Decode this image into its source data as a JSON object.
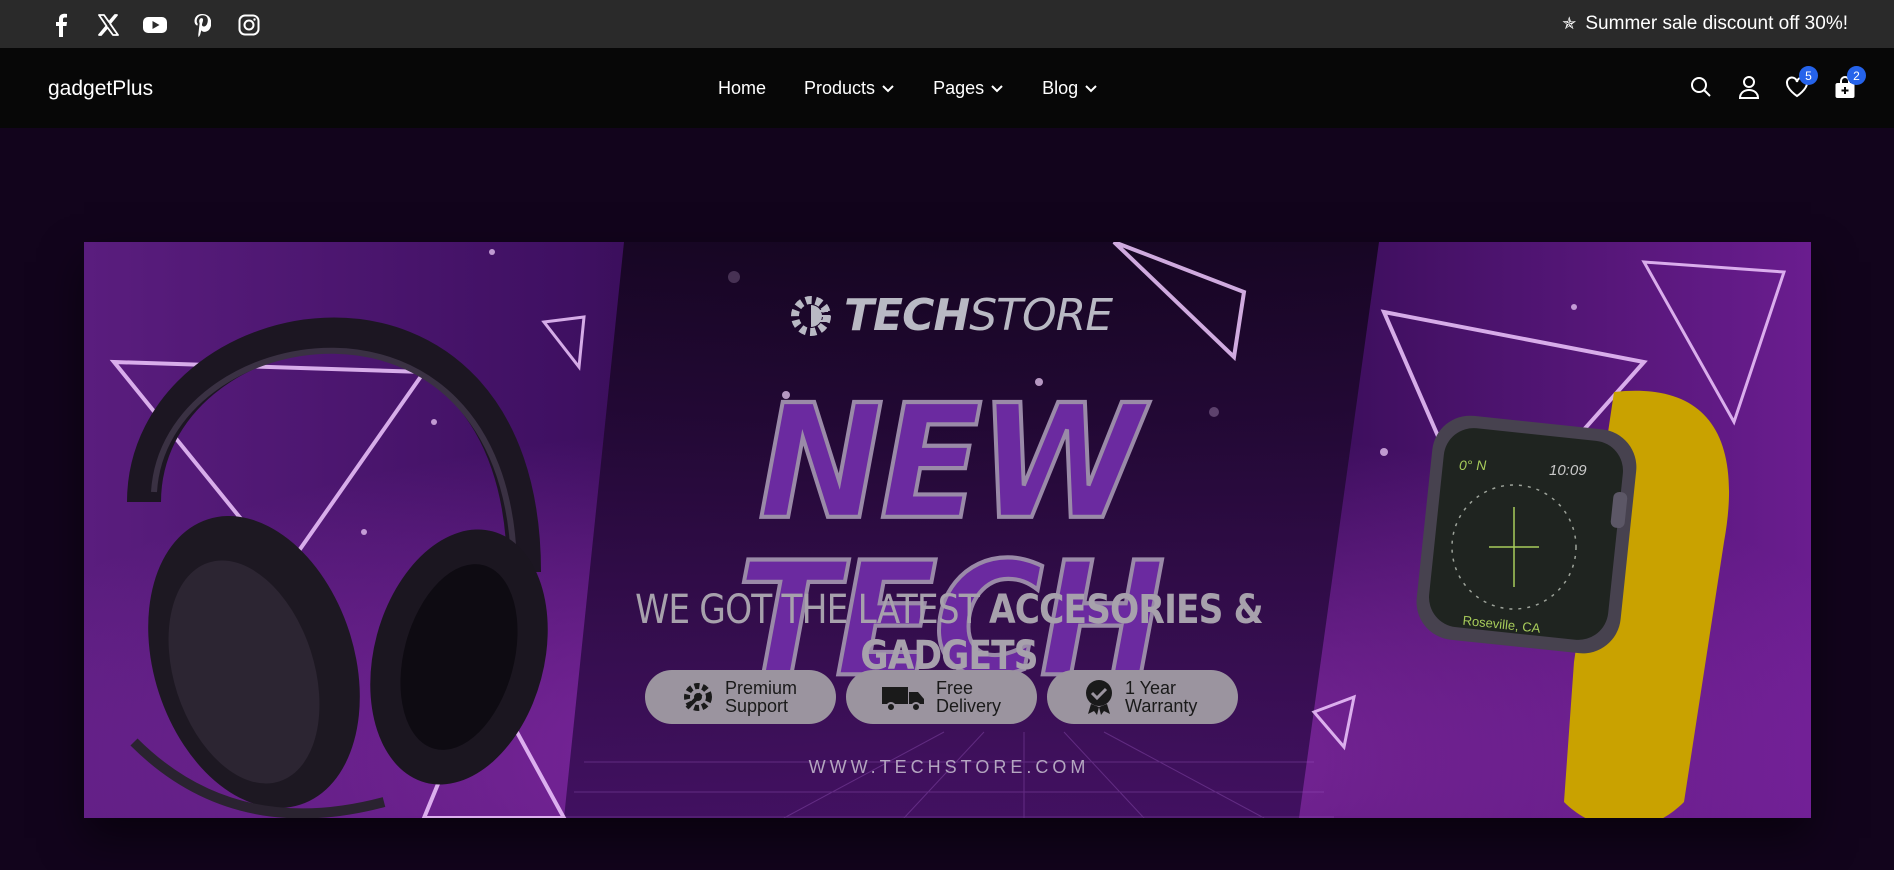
{
  "topbar": {
    "social_icons": [
      "facebook-icon",
      "x-icon",
      "youtube-icon",
      "pinterest-icon",
      "instagram-icon"
    ],
    "promo_icon": "star-icon",
    "promo_text": "Summer sale discount off 30%!"
  },
  "navbar": {
    "logo": "gadgetPlus",
    "menu": [
      {
        "label": "Home",
        "dropdown": false
      },
      {
        "label": "Products",
        "dropdown": true
      },
      {
        "label": "Pages",
        "dropdown": true
      },
      {
        "label": "Blog",
        "dropdown": true
      }
    ],
    "actions": {
      "search_icon": "search-icon",
      "account_icon": "user-icon",
      "wishlist_count": "5",
      "cart_count": "2"
    }
  },
  "banner": {
    "brand_bold": "TECH",
    "brand_light": "STORE",
    "headline": "NEW TECH",
    "subline_light": "WE GOT THE LATEST ",
    "subline_bold": "ACCESORIES & GADGETS",
    "features": [
      {
        "line1": "Premium",
        "line2": "Support",
        "icon": "gear-wrench-icon"
      },
      {
        "line1": "Free",
        "line2": "Delivery",
        "icon": "truck-icon"
      },
      {
        "line1": "1 Year",
        "line2": "Warranty",
        "icon": "warranty-badge-icon"
      }
    ],
    "url": "WWW.TECHSTORE.COM",
    "watch": {
      "heading": "0° N",
      "time": "10:09",
      "location": "Roseville, CA"
    }
  },
  "colors": {
    "topbar_bg": "#2a2a2a",
    "navbar_bg": "#070707",
    "badge": "#2563eb",
    "banner_purple": "#6b2aa0",
    "watch_band": "#c9a200"
  }
}
